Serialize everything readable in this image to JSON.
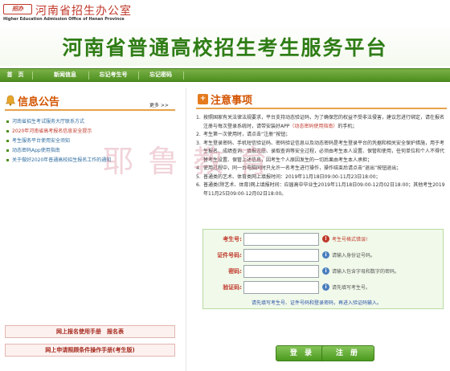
{
  "brand": {
    "logo_text": "招办",
    "org_name": "河南省招生办公室",
    "org_en": "Higher Education Admission Office of Henan Province"
  },
  "banner": {
    "title": "河南省普通高校招生考生服务平台"
  },
  "nav": {
    "items": [
      {
        "label": "首　页"
      },
      {
        "label": "新闻信息"
      },
      {
        "label": "忘记考生号"
      },
      {
        "label": "忘记密码"
      }
    ]
  },
  "news": {
    "title": "信息公告",
    "more_label": "更多 >>",
    "items": [
      {
        "text": "河南省招生考试服务大厅联系方式"
      },
      {
        "text": "2020年河南省高考报名信息安全提示"
      },
      {
        "text": "考生服务平台使用安全须知"
      },
      {
        "text": "动态密码App使用指南"
      },
      {
        "text": "关于做好2020年普通高校招生报名工作的通知"
      }
    ],
    "manuals": [
      {
        "label": "网上报名使用手册　报名表"
      },
      {
        "label": "网上申请照顾条件操作手册(考生版)"
      }
    ]
  },
  "notice": {
    "title": "注意事项",
    "items": [
      {
        "num": "1.",
        "text": "按照国家有关法律法规要求，平台支持动态验证码，为了确保您的权益不受非法侵害，建议您进行绑定，请在报名注册与每次登录系统时，请带安装好APP",
        "red": "（动态密码使用指南）",
        "tail": "的手机；"
      },
      {
        "num": "2.",
        "text": "考生第一次使用时，请点击“注册”按钮；",
        "red": "",
        "tail": ""
      },
      {
        "num": "3.",
        "text": "考生登录密码、手机短信验证码、密码验证信息以及动态密码是考生登录平台的凭据和相关安全保护措施，用于考生报名、成绩查询、填报志愿、录取查询等安全过程，必须由考生本人设置、保管和使用，任何单位和个人不得代替考生设置、保管上述信息，因考生个人原因发生的一切后果由考生本人承担；",
        "red": "",
        "tail": ""
      },
      {
        "num": "4.",
        "text": "使用过程中，同一台电脑同时只允许一名考生进行操作，操作结束后请点击“退出”按钮退出；",
        "red": "",
        "tail": ""
      },
      {
        "num": "5.",
        "text": "普通类的艺术、体育类网上填报时间：2019年11月18日09:00-11月23日18:00；",
        "red": "",
        "tail": ""
      },
      {
        "num": "6.",
        "text": "普通类(除艺术、体育)网上填报时间：应届高中毕业生2019年11月18日09:00-12月02日18:00；其他考生2019年11月25日09:00-12月02日18:00。",
        "red": "",
        "tail": ""
      }
    ]
  },
  "login": {
    "fields": [
      {
        "label": "考生号:",
        "value": "",
        "hint": "考生号格式错误!",
        "hint_type": "err"
      },
      {
        "label": "证件号码:",
        "value": "",
        "hint": "请输入身份证号码。",
        "hint_type": "info"
      },
      {
        "label": "密码:",
        "value": "",
        "hint": "请输入包含字母和数字的密码。",
        "hint_type": "info"
      },
      {
        "label": "验证码:",
        "value": "",
        "hint": "请先填写考生号。",
        "hint_type": "info"
      }
    ],
    "tip": "请先填写考生号、证件号码和登录密码，再进入验证码输入。",
    "login_label": "登 录",
    "register_label": "注 册"
  },
  "watermark": "耶鲁教育",
  "colors": {
    "brand_green": "#2f7d16",
    "nav_green": "#4e8f1f",
    "accent_orange": "#d35400",
    "error_red": "#c0392b"
  }
}
